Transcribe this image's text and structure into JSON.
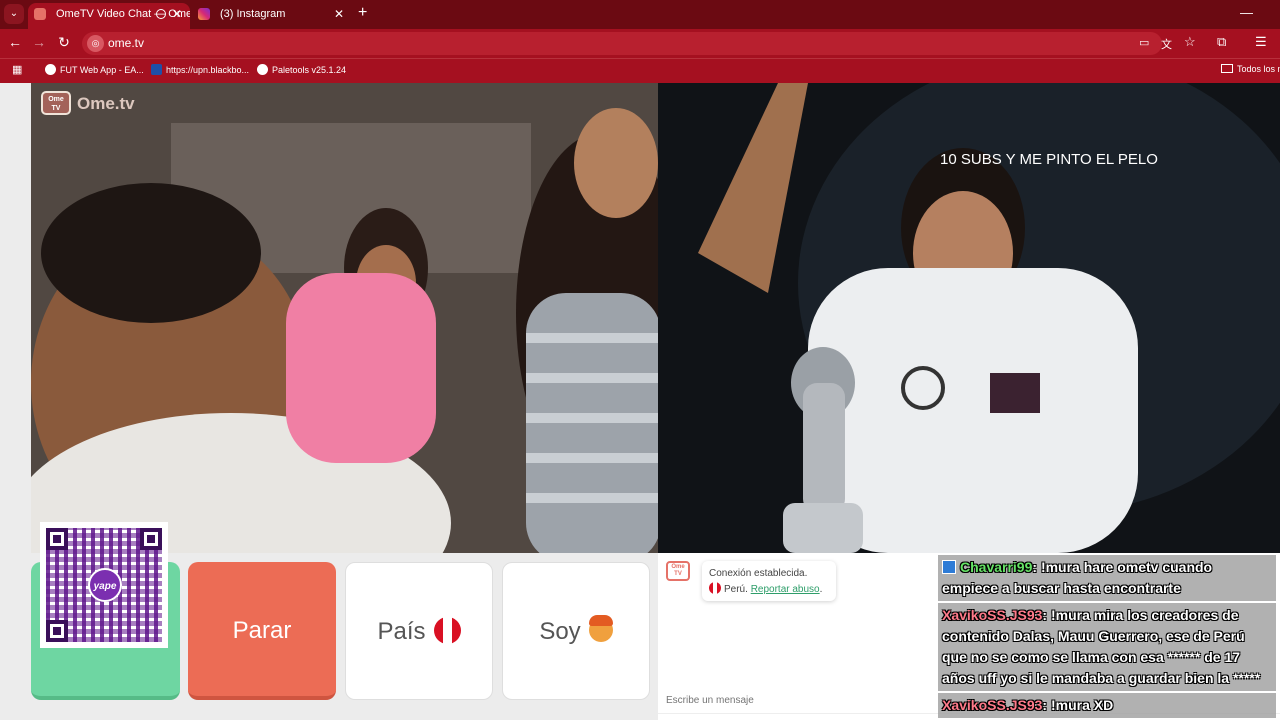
{
  "browser": {
    "tabs": [
      {
        "title": "OmeTV Video Chat — Ome",
        "active": true
      },
      {
        "title": "(3) Instagram",
        "active": false
      }
    ],
    "url": "ome.tv",
    "bookmarks": [
      "FUT Web App - EA...",
      "https://upn.blackbo...",
      "Paletools v25.1.24"
    ],
    "bookmarks_right": "Todos los m",
    "accent": "#a51020"
  },
  "video": {
    "logo_text": "Ome.tv",
    "logo_badge": "Ome TV",
    "overlay_text": "10 SUBS Y ME PINTO EL PELO"
  },
  "controls": {
    "stop_label": "Parar",
    "country_label": "País",
    "gender_label": "Soy",
    "qr_brand": "yape"
  },
  "chat": {
    "system_line1": "Conexión establecida.",
    "system_country": "Perú.",
    "report_link": "Reportar abuso",
    "input_placeholder": "Escribe un mensaje"
  },
  "stream_chat": [
    {
      "user": "Chavarri99",
      "text": ": !mura hare ometv cuando empiece a buscar hasta encontrarte"
    },
    {
      "user": "XavikoSS.JS93",
      "text": ": !mura mira los creadores de contenido Dalas, Mauu Guerrero, ese de Perú que no se como se llama con esa ****** de 17 años uff yo si le mandaba a guardar bien la *****"
    },
    {
      "user": "XavikoSS.JS93",
      "text": ": !mura XD"
    }
  ]
}
